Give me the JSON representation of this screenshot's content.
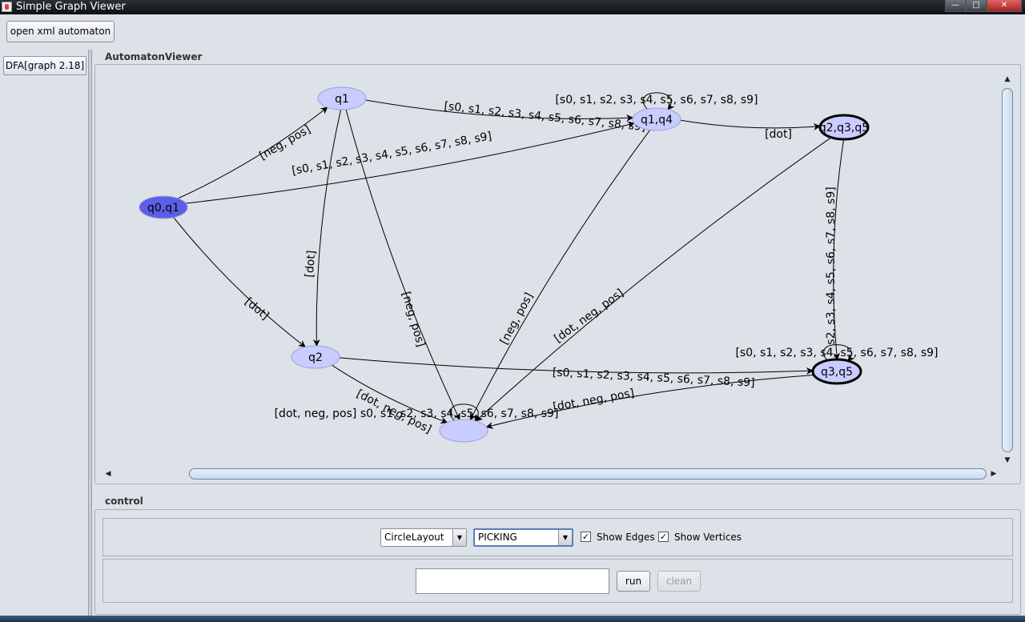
{
  "window": {
    "title": "Simple Graph Viewer"
  },
  "toolbar": {
    "open_label": "open xml automaton"
  },
  "sidebar": {
    "tab_label": "DFA[graph 2.18]"
  },
  "viewer": {
    "label": "AutomatonViewer"
  },
  "graph": {
    "nodes": [
      {
        "id": "q0q1",
        "label": "q0,q1",
        "kind": "initial"
      },
      {
        "id": "q1",
        "label": "q1",
        "kind": "normal"
      },
      {
        "id": "q1q4",
        "label": "q1,q4",
        "kind": "normal"
      },
      {
        "id": "q2q3q5",
        "label": "q2,q3,q5",
        "kind": "accepting"
      },
      {
        "id": "q2",
        "label": "q2",
        "kind": "normal"
      },
      {
        "id": "q3q5",
        "label": "q3,q5",
        "kind": "accepting"
      },
      {
        "id": "sink",
        "label": "",
        "kind": "normal"
      }
    ],
    "edges": [
      {
        "from": "q0q1",
        "to": "q1",
        "label": "[neg, pos]"
      },
      {
        "from": "q0q1",
        "to": "q1q4",
        "label": "[s0, s1, s2, s3, s4, s5, s6, s7, s8, s9]"
      },
      {
        "from": "q0q1",
        "to": "q2",
        "label": "[dot]"
      },
      {
        "from": "q1",
        "to": "q1q4",
        "label": "[s0, s1, s2, s3, s4, s5, s6, s7, s8, s9]"
      },
      {
        "from": "q1",
        "to": "q2",
        "label": "[dot]"
      },
      {
        "from": "q1",
        "to": "sink",
        "label": "[neg, pos]"
      },
      {
        "from": "q1q4",
        "to": "q1q4",
        "label": "[s0, s1, s2, s3, s4, s5, s6, s7, s8, s9]"
      },
      {
        "from": "q1q4",
        "to": "q2q3q5",
        "label": "[dot]"
      },
      {
        "from": "q1q4",
        "to": "sink",
        "label": "[neg, pos]"
      },
      {
        "from": "q2q3q5",
        "to": "q3q5",
        "label": "s2, s3, s4, s5, s6, s7, s8, s9]"
      },
      {
        "from": "q2q3q5",
        "to": "sink",
        "label": "[dot, neg, pos]"
      },
      {
        "from": "q3q5",
        "to": "q3q5",
        "label": "[s0, s1, s2, s3, s4, s5, s6, s7, s8, s9]"
      },
      {
        "from": "q2",
        "to": "q3q5",
        "label": "[s0, s1, s2, s3, s4, s5, s6, s7, s8, s9]"
      },
      {
        "from": "q3q5",
        "to": "sink",
        "label": "[dot, neg, pos]"
      },
      {
        "from": "q2",
        "to": "sink",
        "label": "[dot, neg, pos]"
      },
      {
        "from": "sink",
        "to": "sink",
        "label": "[dot, neg, pos] s0, s1, s2, s3, s4, s5, s6, s7, s8, s9]"
      }
    ],
    "colors": {
      "initial": "#5b5ee6",
      "normal": "#c9ccff",
      "edge": "#000000"
    }
  },
  "control": {
    "label": "control",
    "layout_value": "CircleLayout",
    "mode_value": "PICKING",
    "show_edges_label": "Show Edges",
    "show_edges_checked": true,
    "show_vertices_label": "Show Vertices",
    "show_vertices_checked": true,
    "input_value": "",
    "run_label": "run",
    "clean_label": "clean"
  }
}
